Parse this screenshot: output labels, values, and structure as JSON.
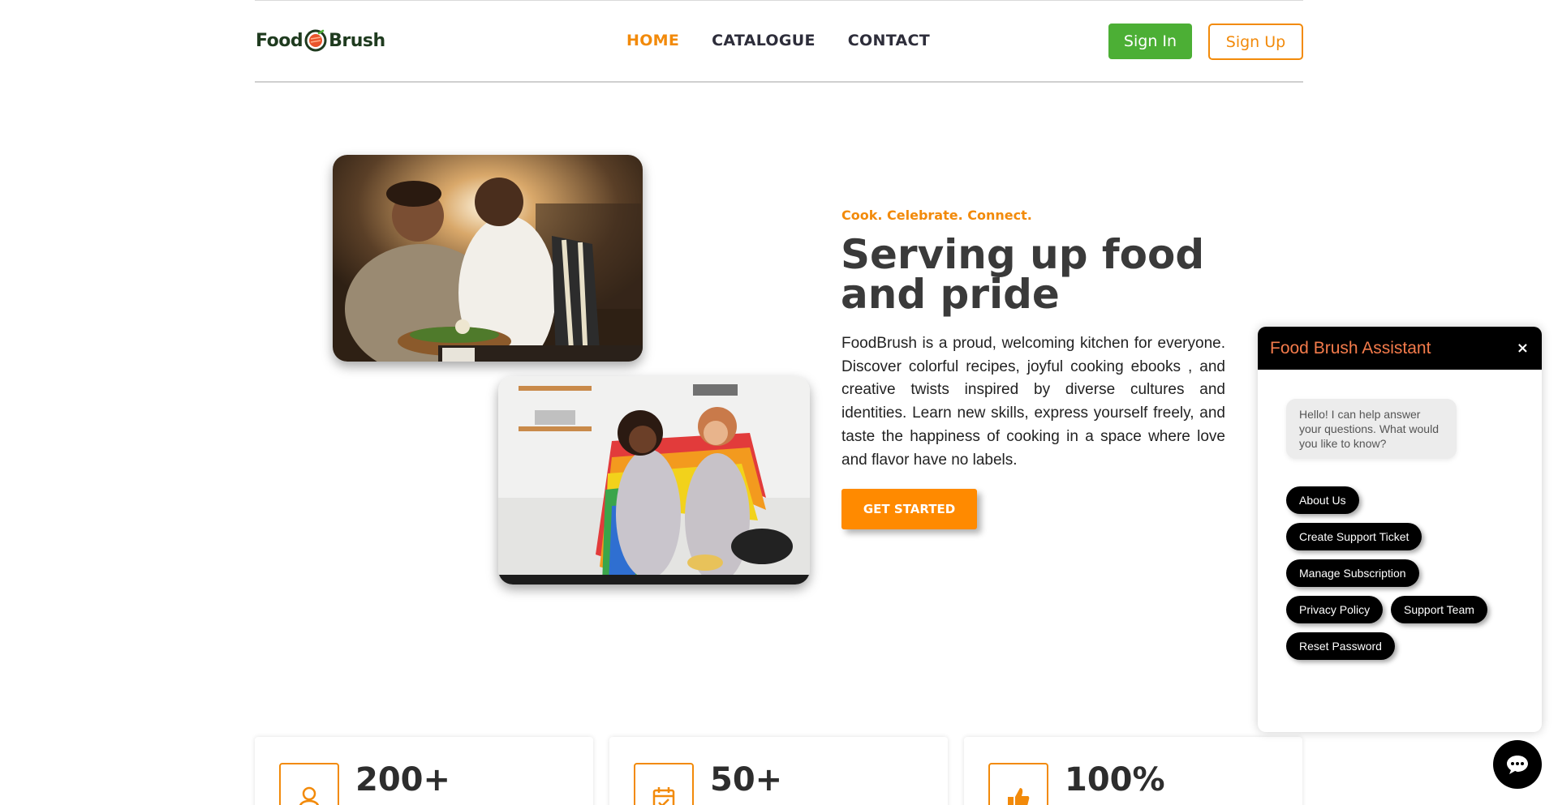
{
  "header": {
    "logo_text_left": "Food",
    "logo_text_right": "Brush",
    "nav": {
      "home": "HOME",
      "catalogue": "CATALOGUE",
      "contact": "CONTACT"
    },
    "sign_in": "Sign In",
    "sign_up": "Sign Up"
  },
  "hero": {
    "tagline": "Cook. Celebrate. Connect.",
    "title": "Serving up food and pride",
    "description": "FoodBrush is a proud, welcoming kitchen for everyone. Discover colorful recipes, joyful cooking ebooks , and creative twists inspired by diverse cultures and identities. Learn new skills, express yourself freely, and taste the happiness of cooking in a space where love and flavor have no labels.",
    "cta": "GET STARTED"
  },
  "stats": [
    {
      "value": "200+",
      "icon": "user-icon"
    },
    {
      "value": "50+",
      "icon": "calendar-check-icon"
    },
    {
      "value": "100%",
      "icon": "thumbs-up-icon"
    }
  ],
  "chat": {
    "title": "Food Brush Assistant",
    "close": "×",
    "greeting": "Hello! I can help answer your questions. What would you like to know?",
    "options": [
      "About Us",
      "Create Support Ticket",
      "Manage Subscription",
      "Privacy Policy",
      "Support Team",
      "Reset Password"
    ]
  },
  "colors": {
    "accent": "#f28a0a",
    "sign_in_green": "#4caf35",
    "chat_title": "#f47b4b",
    "dark": "#000000"
  }
}
